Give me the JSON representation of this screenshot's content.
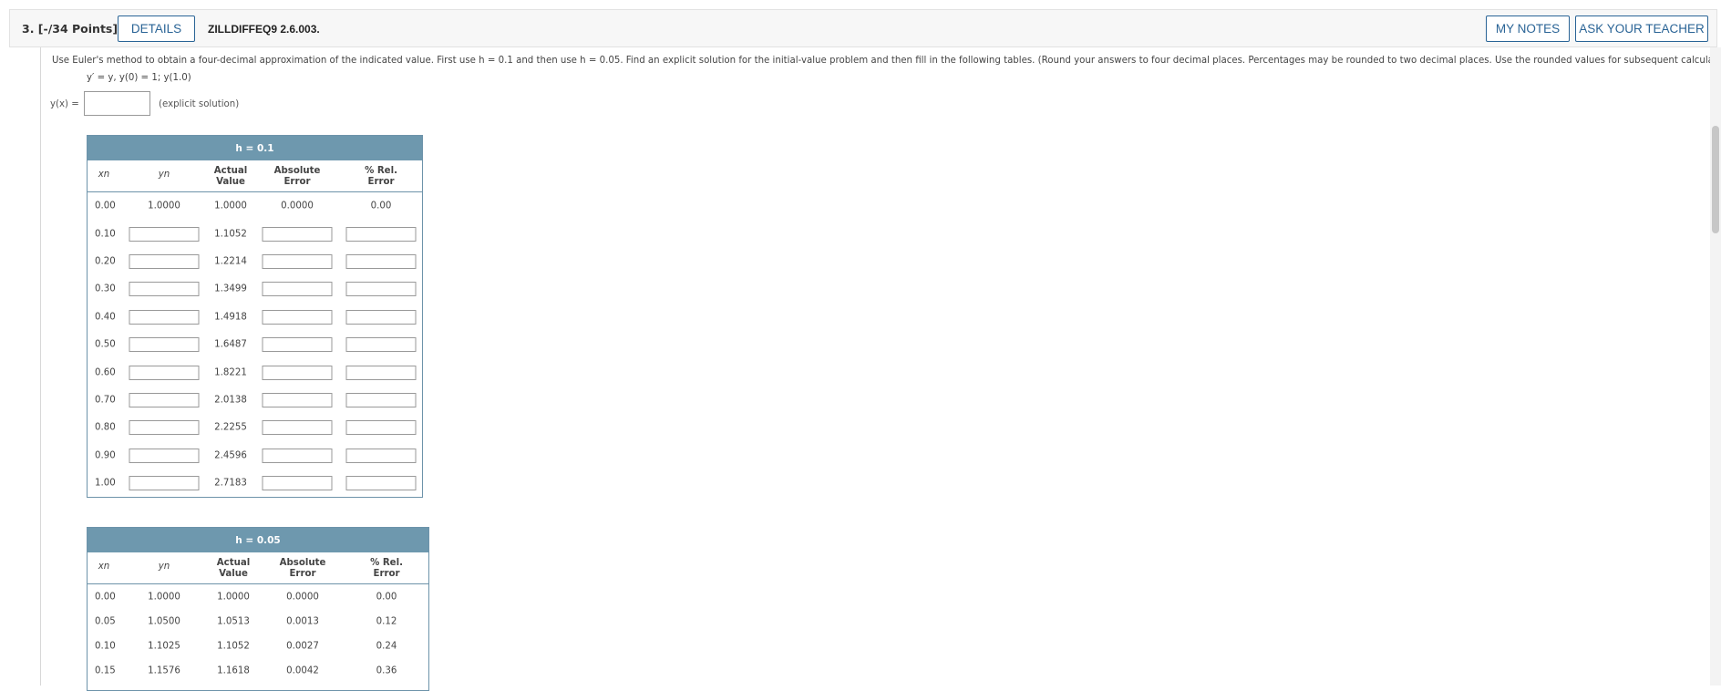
{
  "header": {
    "question_label": "3. [-/34 Points]",
    "details_button": "DETAILS",
    "question_id": "ZILLDIFFEQ9 2.6.003.",
    "my_notes_button": "MY NOTES",
    "ask_teacher_button": "ASK YOUR TEACHER"
  },
  "question": {
    "instructions": "Use Euler's method to obtain a four-decimal approximation of the indicated value. First use h = 0.1 and then use h = 0.05. Find an explicit solution for the initial-value problem and then fill in the following tables. (Round your answers to four decimal places. Percentages may be rounded to two decimal places. Use the rounded values for subsequent calculations.)",
    "equation": "y′ = y,   y(0) = 1;  y(1.0)",
    "explicit_label": "y(x) =",
    "explicit_note": "(explicit solution)",
    "explicit_value": ""
  },
  "table1": {
    "title": "h = 0.1",
    "headers": {
      "xn": "xn",
      "yn": "yn",
      "actual_1": "Actual",
      "actual_2": "Value",
      "abs_1": "Absolute",
      "abs_2": "Error",
      "rel_1": "% Rel.",
      "rel_2": "Error"
    },
    "rows": [
      {
        "x": "0.00",
        "y": "1.0000",
        "actual": "1.0000",
        "abs": "0.0000",
        "rel": "0.00"
      },
      {
        "x": "0.10",
        "y": "",
        "actual": "1.1052",
        "abs": "",
        "rel": ""
      },
      {
        "x": "0.20",
        "y": "",
        "actual": "1.2214",
        "abs": "",
        "rel": ""
      },
      {
        "x": "0.30",
        "y": "",
        "actual": "1.3499",
        "abs": "",
        "rel": ""
      },
      {
        "x": "0.40",
        "y": "",
        "actual": "1.4918",
        "abs": "",
        "rel": ""
      },
      {
        "x": "0.50",
        "y": "",
        "actual": "1.6487",
        "abs": "",
        "rel": ""
      },
      {
        "x": "0.60",
        "y": "",
        "actual": "1.8221",
        "abs": "",
        "rel": ""
      },
      {
        "x": "0.70",
        "y": "",
        "actual": "2.0138",
        "abs": "",
        "rel": ""
      },
      {
        "x": "0.80",
        "y": "",
        "actual": "2.2255",
        "abs": "",
        "rel": ""
      },
      {
        "x": "0.90",
        "y": "",
        "actual": "2.4596",
        "abs": "",
        "rel": ""
      },
      {
        "x": "1.00",
        "y": "",
        "actual": "2.7183",
        "abs": "",
        "rel": ""
      }
    ]
  },
  "table2": {
    "title": "h = 0.05",
    "headers": {
      "xn": "xn",
      "yn": "yn",
      "actual_1": "Actual",
      "actual_2": "Value",
      "abs_1": "Absolute",
      "abs_2": "Error",
      "rel_1": "% Rel.",
      "rel_2": "Error"
    },
    "rows": [
      {
        "x": "0.00",
        "y": "1.0000",
        "actual": "1.0000",
        "abs": "0.0000",
        "rel": "0.00"
      },
      {
        "x": "0.05",
        "y": "1.0500",
        "actual": "1.0513",
        "abs": "0.0013",
        "rel": "0.12"
      },
      {
        "x": "0.10",
        "y": "1.1025",
        "actual": "1.1052",
        "abs": "0.0027",
        "rel": "0.24"
      },
      {
        "x": "0.15",
        "y": "1.1576",
        "actual": "1.1618",
        "abs": "0.0042",
        "rel": "0.36"
      }
    ]
  }
}
